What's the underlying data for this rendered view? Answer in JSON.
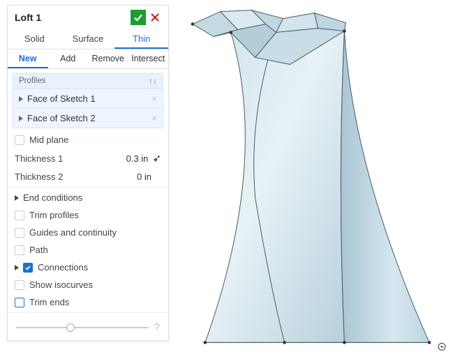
{
  "header": {
    "title": "Loft 1"
  },
  "tabs": {
    "solid": "Solid",
    "surface": "Surface",
    "thin": "Thin",
    "active": "thin"
  },
  "subtabs": {
    "new": "New",
    "add": "Add",
    "remove": "Remove",
    "intersect": "Intersect",
    "active": "new"
  },
  "profiles": {
    "label": "Profiles",
    "items": [
      {
        "label": "Face of Sketch 1"
      },
      {
        "label": "Face of Sketch 2"
      }
    ]
  },
  "options": {
    "midplane": "Mid plane",
    "thickness1_label": "Thickness 1",
    "thickness1_value": "0.3 in",
    "thickness2_label": "Thickness 2",
    "thickness2_value": "0 in",
    "end_conditions": "End conditions",
    "trim_profiles": "Trim profiles",
    "guides": "Guides and continuity",
    "path": "Path",
    "connections": "Connections",
    "show_iso": "Show isocurves",
    "trim_ends": "Trim ends"
  }
}
